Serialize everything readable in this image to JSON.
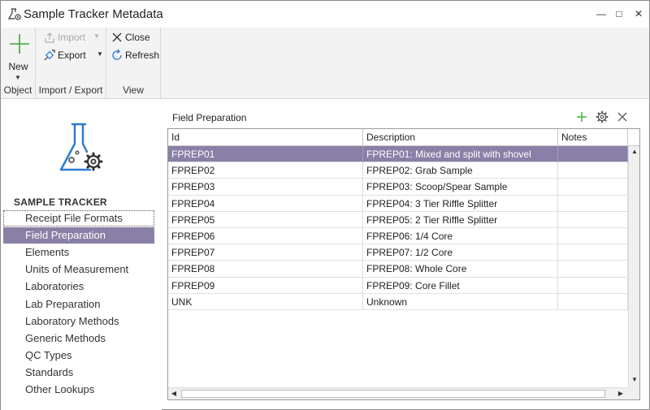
{
  "window": {
    "title": "Sample Tracker Metadata"
  },
  "ribbon": {
    "new_label": "New",
    "import_label": "Import",
    "export_label": "Export",
    "close_label": "Close",
    "refresh_label": "Refresh",
    "group_object": "Object",
    "group_import_export": "Import / Export",
    "group_view": "View"
  },
  "sidebar": {
    "heading": "SAMPLE TRACKER",
    "items": [
      {
        "label": "Receipt File Formats"
      },
      {
        "label": "Field Preparation"
      },
      {
        "label": "Elements"
      },
      {
        "label": "Units of Measurement"
      },
      {
        "label": "Laboratories"
      },
      {
        "label": "Lab Preparation"
      },
      {
        "label": "Laboratory Methods"
      },
      {
        "label": "Generic Methods"
      },
      {
        "label": "QC Types"
      },
      {
        "label": "Standards"
      },
      {
        "label": "Other Lookups"
      }
    ],
    "selected_index": 1,
    "focused_index": 0
  },
  "panel": {
    "title": "Field Preparation",
    "columns": [
      "Id",
      "Description",
      "Notes"
    ],
    "rows": [
      {
        "id": "FPREP01",
        "description": "FPREP01: Mixed and split with shovel",
        "notes": ""
      },
      {
        "id": "FPREP02",
        "description": "FPREP02: Grab Sample",
        "notes": ""
      },
      {
        "id": "FPREP03",
        "description": "FPREP03: Scoop/Spear Sample",
        "notes": ""
      },
      {
        "id": "FPREP04",
        "description": "FPREP04: 3 Tier Riffle Splitter",
        "notes": ""
      },
      {
        "id": "FPREP05",
        "description": "FPREP05: 2 Tier Riffle Splitter",
        "notes": ""
      },
      {
        "id": "FPREP06",
        "description": "FPREP06: 1/4 Core",
        "notes": ""
      },
      {
        "id": "FPREP07",
        "description": "FPREP07: 1/2 Core",
        "notes": ""
      },
      {
        "id": "FPREP08",
        "description": "FPREP08: Whole Core",
        "notes": ""
      },
      {
        "id": "FPREP09",
        "description": "FPREP09: Core Fillet",
        "notes": ""
      },
      {
        "id": "UNK",
        "description": "Unknown",
        "notes": ""
      }
    ],
    "selected_row": 0
  },
  "colors": {
    "accent": "#8a7fa6",
    "icon_blue": "#2b7cd3",
    "icon_green": "#3aaa35"
  },
  "icons": [
    "flask-gear-icon",
    "plus-icon",
    "import-icon",
    "export-icon",
    "close-icon",
    "refresh-icon",
    "gear-icon"
  ]
}
